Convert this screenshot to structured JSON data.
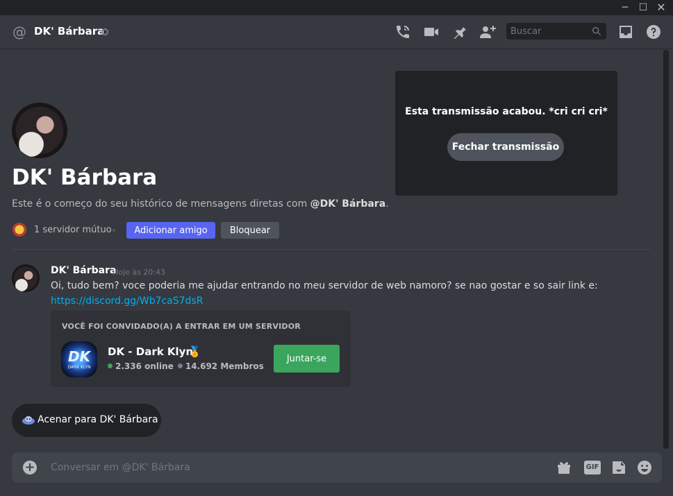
{
  "window": {
    "minimize_glyph": "─",
    "maximize_glyph": "☐",
    "close_glyph": "✕"
  },
  "header": {
    "at_glyph": "@",
    "title": "DK' Bárbara",
    "search_placeholder": "Buscar",
    "icons": [
      "voice-call-icon",
      "video-call-icon",
      "pin-icon",
      "add-friend-icon",
      "search-icon",
      "inbox-icon",
      "help-icon"
    ]
  },
  "profile": {
    "name": "DK' Bárbara",
    "intro_prefix": "Este é o começo do seu histórico de mensagens diretas com ",
    "intro_mention": "@DK' Bárbara",
    "intro_suffix": ".",
    "mutual_servers": "1 servidor mútuo",
    "add_friend_label": "Adicionar amigo",
    "block_label": "Bloquear"
  },
  "stream": {
    "message": "Esta transmissão acabou. *cri cri cri*",
    "close_label": "Fechar transmissão"
  },
  "message": {
    "author": "DK' Bárbara",
    "timestamp": "Hoje às 20:43",
    "text": "Oi, tudo bem? voce poderia me ajudar entrando no meu servidor de web namoro? se nao gostar e so sair link e:",
    "link": "https://discord.gg/Wb7caS7dsR"
  },
  "invite": {
    "header": "VOCÊ FOI CONVIDADO(A) A ENTRAR EM UM SERVIDOR",
    "server_icon_text": "DK",
    "server_icon_subtext": "DARK KLYN",
    "server_name": "DK - Dark Klyn",
    "medal_glyph": "🏅",
    "online": "2.336 online",
    "members": "14.692 Membros",
    "join_label": "Juntar-se"
  },
  "wave": {
    "label": "Acenar para DK' Bárbara"
  },
  "chatbar": {
    "plus_glyph": "+",
    "placeholder": "Conversar em @DK' Bárbara",
    "gif_label": "GIF"
  },
  "colors": {
    "background": "#36393f",
    "accent": "#5865f2",
    "join_green": "#3ba55d",
    "link": "#00aff4"
  }
}
